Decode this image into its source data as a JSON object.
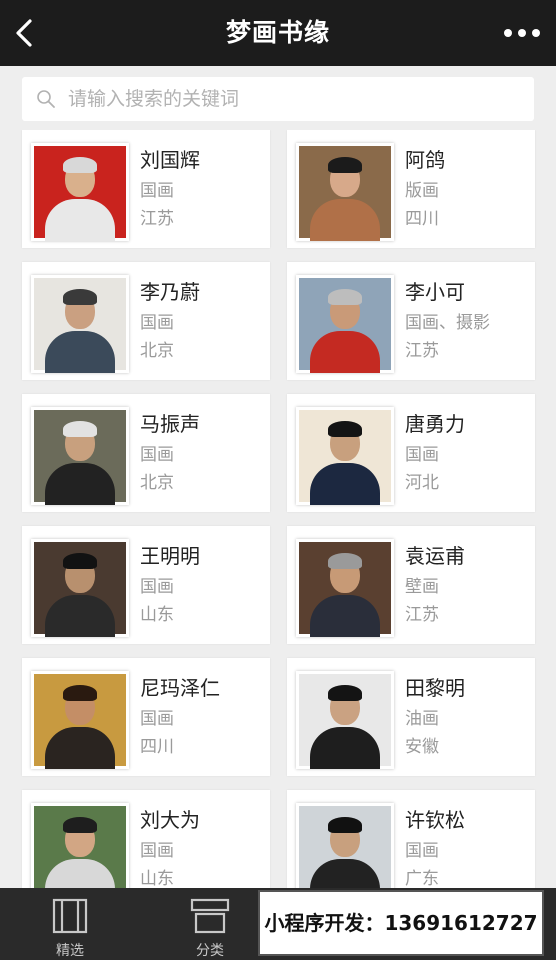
{
  "header": {
    "title": "梦画书缘",
    "back_icon": "chevron-left-icon",
    "more_icon": "ellipsis-icon"
  },
  "search": {
    "placeholder": "请输入搜索的关键词"
  },
  "artists": [
    {
      "name": "刘国辉",
      "category": "国画",
      "location": "江苏",
      "palette": {
        "bg": "#c9231e",
        "hair": "#d8d8d8",
        "skin": "#d9b08c",
        "body": "#e8e8e8"
      }
    },
    {
      "name": "阿鸽",
      "category": "版画",
      "location": "四川",
      "palette": {
        "bg": "#8a6a4a",
        "hair": "#1b1b1b",
        "skin": "#d7a98a",
        "body": "#b07048"
      }
    },
    {
      "name": "李乃蔚",
      "category": "国画",
      "location": "北京",
      "palette": {
        "bg": "#e7e5e0",
        "hair": "#3a3a3a",
        "skin": "#caa081",
        "body": "#3b4a5a"
      }
    },
    {
      "name": "李小可",
      "category": "国画、摄影",
      "location": "江苏",
      "palette": {
        "bg": "#8fa4b8",
        "hair": "#bdbdbd",
        "skin": "#c99a78",
        "body": "#c42a22"
      }
    },
    {
      "name": "马振声",
      "category": "国画",
      "location": "北京",
      "palette": {
        "bg": "#6b6b5a",
        "hair": "#e2e2e2",
        "skin": "#c8a07e",
        "body": "#222222"
      }
    },
    {
      "name": "唐勇力",
      "category": "国画",
      "location": "河北",
      "palette": {
        "bg": "#efe6d6",
        "hair": "#141414",
        "skin": "#c8a07e",
        "body": "#1c2840"
      }
    },
    {
      "name": "王明明",
      "category": "国画",
      "location": "山东",
      "palette": {
        "bg": "#4a3a30",
        "hair": "#121212",
        "skin": "#b8906e",
        "body": "#2a2a2a"
      }
    },
    {
      "name": "袁运甫",
      "category": "壁画",
      "location": "江苏",
      "palette": {
        "bg": "#5a4030",
        "hair": "#9a9a9a",
        "skin": "#c79a76",
        "body": "#2a2e3a"
      }
    },
    {
      "name": "尼玛泽仁",
      "category": "国画",
      "location": "四川",
      "palette": {
        "bg": "#c89a40",
        "hair": "#2a1a10",
        "skin": "#c48e66",
        "body": "#2a2420"
      }
    },
    {
      "name": "田黎明",
      "category": "油画",
      "location": "安徽",
      "palette": {
        "bg": "#e8e8e8",
        "hair": "#141414",
        "skin": "#caa282",
        "body": "#1e1e1e"
      }
    },
    {
      "name": "刘大为",
      "category": "国画",
      "location": "山东",
      "palette": {
        "bg": "#5a7a4a",
        "hair": "#1e1e1e",
        "skin": "#d2a684",
        "body": "#d8d8d8"
      }
    },
    {
      "name": "许钦松",
      "category": "国画",
      "location": "广东",
      "palette": {
        "bg": "#cfd4d8",
        "hair": "#111111",
        "skin": "#c8a07e",
        "body": "#222222"
      }
    }
  ],
  "tabs": [
    {
      "label": "精选",
      "icon": "featured-icon"
    },
    {
      "label": "分类",
      "icon": "category-icon"
    }
  ],
  "promo": {
    "text": "小程序开发：13691612727"
  }
}
